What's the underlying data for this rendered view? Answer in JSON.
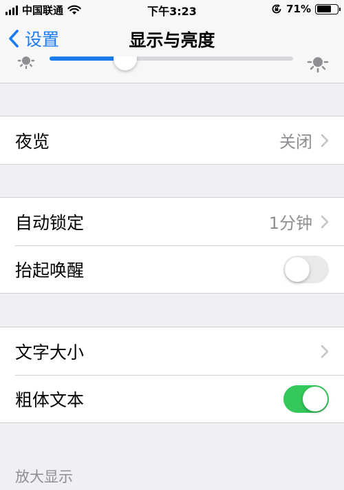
{
  "status_bar": {
    "carrier": "中国联通",
    "time": "下午3:23",
    "battery_percent": "71%",
    "battery_level": 0.71,
    "icons": [
      "signal-icon",
      "wifi-icon",
      "orientation-lock-icon",
      "battery-icon"
    ]
  },
  "nav": {
    "back_label": "设置",
    "title": "显示与亮度"
  },
  "brightness": {
    "level": 0.31,
    "accent_color": "#1a7cf0"
  },
  "groups": {
    "night_shift": {
      "label": "夜览",
      "value": "关闭"
    },
    "lock": {
      "auto_lock_label": "自动锁定",
      "auto_lock_value": "1分钟",
      "raise_to_wake_label": "抬起唤醒",
      "raise_to_wake_on": false
    },
    "text": {
      "text_size_label": "文字大小",
      "bold_text_label": "粗体文本",
      "bold_text_on": true
    }
  },
  "section_zoom_header": "放大显示",
  "colors": {
    "accent": "#1a7cf0",
    "toggle_on": "#34c759",
    "secondary_text": "#8e8e93",
    "background": "#efeff4"
  }
}
